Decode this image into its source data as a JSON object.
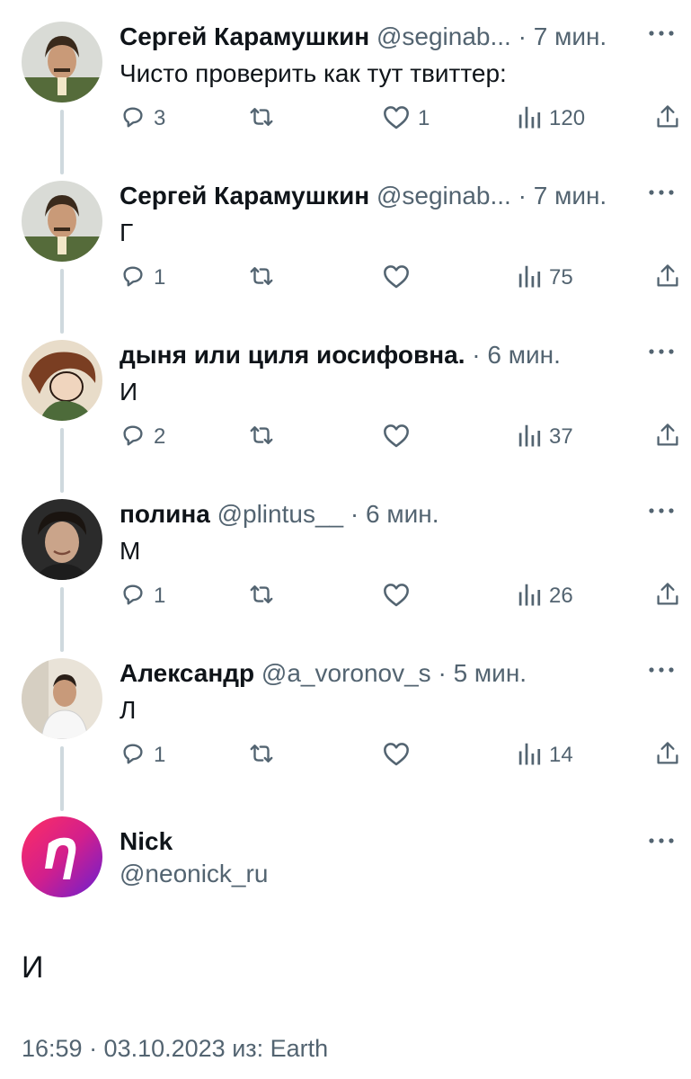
{
  "tweets": [
    {
      "name": "Сергей Карамушкин",
      "handle": "@seginab...",
      "time": "7 мин.",
      "text": "Чисто проверить как тут твиттер:",
      "replies": "3",
      "retweets": "",
      "likes": "1",
      "views": "120"
    },
    {
      "name": "Сергей Карамушкин",
      "handle": "@seginab...",
      "time": "7 мин.",
      "text": "Г",
      "replies": "1",
      "retweets": "",
      "likes": "",
      "views": "75"
    },
    {
      "name": "дыня или циля иосифовна.",
      "handle": "",
      "time": "6 мин.",
      "text": "И",
      "replies": "2",
      "retweets": "",
      "likes": "",
      "views": "37"
    },
    {
      "name": "полина",
      "handle": "@plintus__",
      "time": "6 мин.",
      "text": "М",
      "replies": "1",
      "retweets": "",
      "likes": "",
      "views": "26"
    },
    {
      "name": "Александр",
      "handle": "@a_voronov_s",
      "time": "5 мин.",
      "text": "Л",
      "replies": "1",
      "retweets": "",
      "likes": "",
      "views": "14"
    }
  ],
  "main_tweet": {
    "name": "Nick",
    "handle": "@neonick_ru",
    "text": "И",
    "meta": "16:59 · 03.10.2023 из: Earth"
  },
  "separator": "·",
  "icons": [
    "reply-icon",
    "retweet-icon",
    "like-icon",
    "views-icon",
    "share-icon",
    "more-icon"
  ],
  "colors": {
    "text": "#0f1419",
    "secondary": "#536471",
    "thread_line": "#cfd9de"
  }
}
